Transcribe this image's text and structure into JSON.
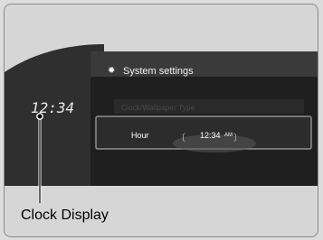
{
  "screen": {
    "title": "System settings",
    "menu_item_greyed": "Clock/Wallpaper Type",
    "hour_label": "Hour",
    "hour_value": "12:34",
    "ampm": "AM"
  },
  "dashboard_clock": "12:34",
  "callout": {
    "label": "Clock Display"
  },
  "colors": {
    "screen_dark": "#2b2b2b",
    "frame_gray": "#d6d6d6",
    "accent_gray": "#8f8f8f"
  },
  "icons": {
    "settings": "gear-icon"
  }
}
